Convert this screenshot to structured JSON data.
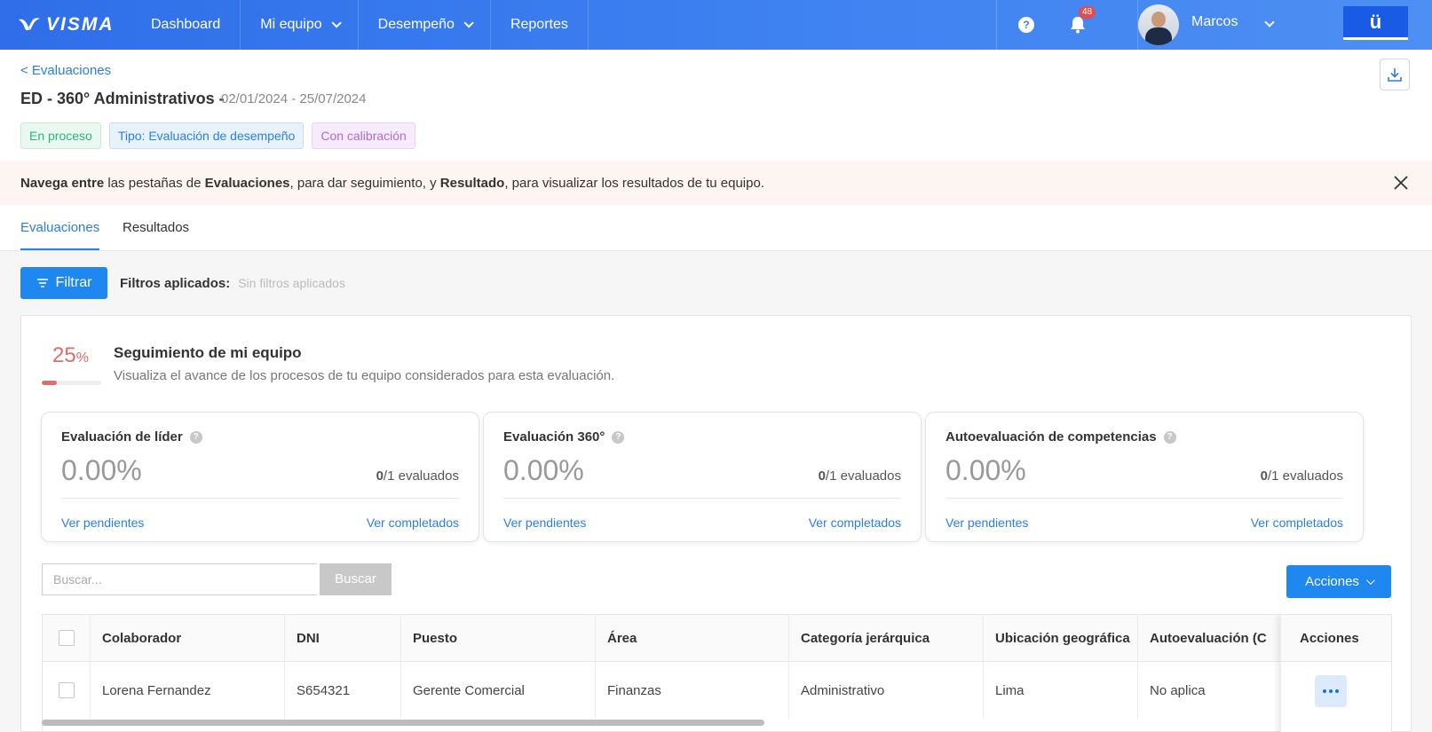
{
  "topbar": {
    "logo": "VISMA",
    "nav": [
      {
        "label": "Dashboard"
      },
      {
        "label": "Mi equipo"
      },
      {
        "label": "Desempeño"
      },
      {
        "label": "Reportes"
      }
    ],
    "help": "?",
    "notifications": "48",
    "user_name": "Marcos",
    "app_button": "ü"
  },
  "header": {
    "back_link": "< Evaluaciones",
    "title": "ED - 360° Administrativos -",
    "dates": "02/01/2024 - 25/07/2024",
    "tags": [
      "En proceso",
      "Tipo: Evaluación de desempeño",
      "Con calibración"
    ]
  },
  "alert": {
    "part1": "Navega entre",
    "part2": " las pestañas de ",
    "part3": "Evaluaciones",
    "part4": ", para dar seguimiento, y ",
    "part5": "Resultado",
    "part6": ", para visualizar los resultados de tu equipo."
  },
  "tabs": [
    "Evaluaciones",
    "Resultados"
  ],
  "filters": {
    "button": "Filtrar",
    "label": "Filtros aplicados:",
    "value": "Sin filtros aplicados"
  },
  "tracking": {
    "percent": "25",
    "percent_sign": "%",
    "progress": 0.25,
    "title": "Seguimiento de mi equipo",
    "subtitle": "Visualiza el avance de los procesos de tu equipo considerados para esta evaluación."
  },
  "metrics": [
    {
      "title": "Evaluación de líder",
      "value": "0.00%",
      "done": "0",
      "total": "/1 evaluados",
      "pending": "Ver pendientes",
      "completed": "Ver completados"
    },
    {
      "title": "Evaluación 360°",
      "value": "0.00%",
      "done": "0",
      "total": "/1 evaluados",
      "pending": "Ver pendientes",
      "completed": "Ver completados"
    },
    {
      "title": "Autoevaluación de competencias",
      "value": "0.00%",
      "done": "0",
      "total": "/1 evaluados",
      "pending": "Ver pendientes",
      "completed": "Ver completados"
    }
  ],
  "search": {
    "placeholder": "Buscar...",
    "button": "Buscar"
  },
  "actions_button": "Acciones",
  "table": {
    "headers": [
      "Colaborador",
      "DNI",
      "Puesto",
      "Área",
      "Categoría jerárquica",
      "Ubicación geográfica",
      "Autoevaluación (C",
      "Acciones"
    ],
    "rows": [
      [
        "Lorena Fernandez",
        "S654321",
        "Gerente Comercial",
        "Finanzas",
        "Administrativo",
        "Lima",
        "No aplica"
      ]
    ]
  }
}
